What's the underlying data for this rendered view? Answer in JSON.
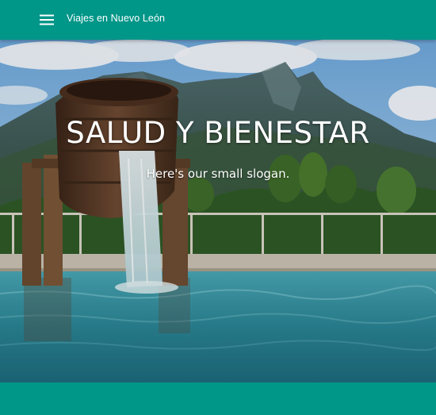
{
  "app_bar": {
    "title": "Viajes en Nuevo León",
    "menu_icon": "hamburger-menu-icon"
  },
  "hero": {
    "title": "SALUD Y BIENESTAR",
    "slogan": "Here's our small slogan."
  },
  "colors": {
    "primary": "#009688",
    "text_on_primary": "#ffffff"
  }
}
